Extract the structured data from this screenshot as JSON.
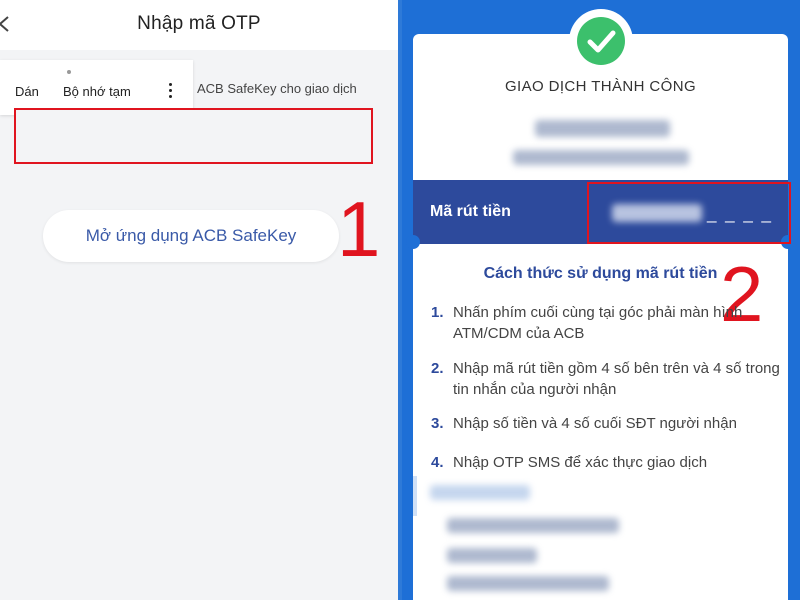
{
  "left_screen": {
    "header": {
      "back_icon": "chevron-left-icon",
      "title": "Nhập mã OTP"
    },
    "context_menu": {
      "paste_label": "Dán",
      "clipboard_label": "Bộ nhớ tạm",
      "more_icon": "more-vertical-icon"
    },
    "hint_text": "ACB SafeKey cho giao dịch",
    "otp_input": {
      "value": ""
    },
    "open_safekey_button": "Mở ứng dụng ACB SafeKey",
    "step_number": "1"
  },
  "right_screen": {
    "success_icon": "check-circle-icon",
    "success_title": "GIAO DỊCH THÀNH CÔNG",
    "withdraw_code": {
      "label": "Mã rút tiền",
      "masked_suffix": "_ _ _ _"
    },
    "step_number": "2",
    "instructions": {
      "title": "Cách thức sử dụng mã rút tiền",
      "items": [
        {
          "num": "1.",
          "text": "Nhấn phím cuối cùng tại góc phải màn hình ATM/CDM của ACB"
        },
        {
          "num": "2.",
          "text": "Nhập mã rút tiền gồm 4 số bên trên và 4 số trong tin nhắn của người nhận"
        },
        {
          "num": "3.",
          "text": "Nhập số tiền và 4 số cuối SĐT người nhận"
        },
        {
          "num": "4.",
          "text": "Nhập OTP SMS để xác thực giao dịch"
        }
      ]
    }
  },
  "colors": {
    "highlight_red": "#e0141f",
    "acb_blue": "#2d4a9c",
    "background_blue": "#1e6fd6",
    "success_green": "#3cc06c",
    "link_blue": "#3a5aa8"
  }
}
